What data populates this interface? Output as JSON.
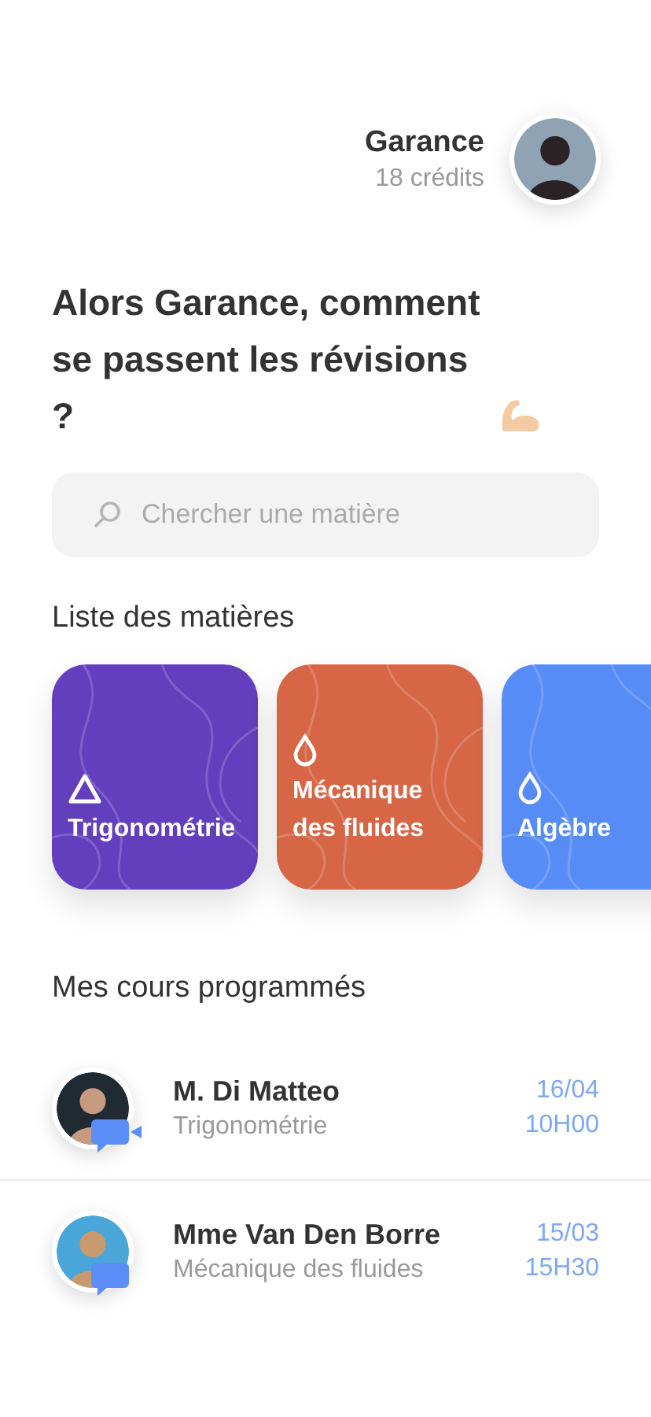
{
  "user": {
    "name": "Garance",
    "credits": "18 crédits"
  },
  "greeting": "Alors Garance, comment se passent les révisions ?",
  "search": {
    "placeholder": "Chercher une matière"
  },
  "subjects_title": "Liste des matières",
  "subjects": [
    {
      "label": "Trigonométrie",
      "kind": "triangle",
      "color": "#633ebd"
    },
    {
      "label": "Mécanique des fluides",
      "kind": "drop",
      "color": "#d66645"
    },
    {
      "label": "Algèbre",
      "kind": "drop",
      "color": "#578cf7"
    }
  ],
  "courses_title": "Mes cours programmés",
  "courses": [
    {
      "teacher": "M. Di Matteo",
      "subject": "Trigonométrie",
      "date": "16/04",
      "time": "10H00",
      "kind": "video"
    },
    {
      "teacher": "Mme Van Den Borre",
      "subject": "Mécanique des fluides",
      "date": "15/03",
      "time": "15H30",
      "kind": "chat"
    }
  ]
}
